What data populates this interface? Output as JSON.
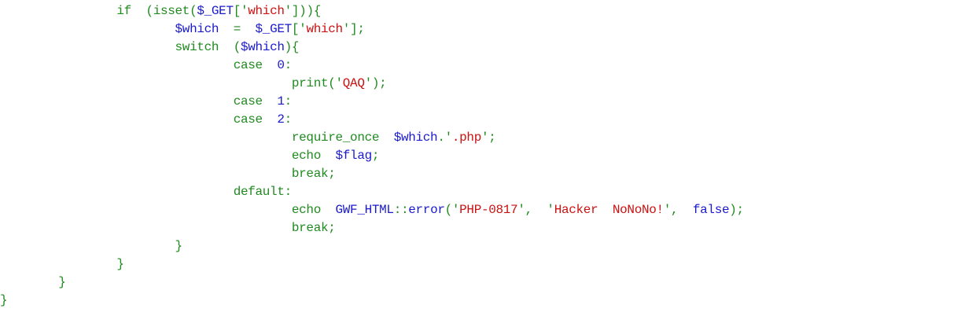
{
  "colors": {
    "keyword": "#1f8a1f",
    "variable": "#1a1acc",
    "string": "#cc1111",
    "punct": "#1f8a1f",
    "plain": "#1f8a1f"
  },
  "code": {
    "lines": [
      [
        {
          "t": "                ",
          "c": "plain"
        },
        {
          "t": "if",
          "c": "keyword"
        },
        {
          "t": "  (isset(",
          "c": "plain"
        },
        {
          "t": "$_GET",
          "c": "variable"
        },
        {
          "t": "['",
          "c": "punct"
        },
        {
          "t": "which",
          "c": "string"
        },
        {
          "t": "'])){",
          "c": "punct"
        }
      ],
      [
        {
          "t": "                        ",
          "c": "plain"
        },
        {
          "t": "$which",
          "c": "variable"
        },
        {
          "t": "  =  ",
          "c": "punct"
        },
        {
          "t": "$_GET",
          "c": "variable"
        },
        {
          "t": "['",
          "c": "punct"
        },
        {
          "t": "which",
          "c": "string"
        },
        {
          "t": "'];",
          "c": "punct"
        }
      ],
      [
        {
          "t": "                        ",
          "c": "plain"
        },
        {
          "t": "switch",
          "c": "keyword"
        },
        {
          "t": "  (",
          "c": "punct"
        },
        {
          "t": "$which",
          "c": "variable"
        },
        {
          "t": "){",
          "c": "punct"
        }
      ],
      [
        {
          "t": "                                ",
          "c": "plain"
        },
        {
          "t": "case",
          "c": "keyword"
        },
        {
          "t": "  ",
          "c": "plain"
        },
        {
          "t": "0",
          "c": "variable"
        },
        {
          "t": ":",
          "c": "punct"
        }
      ],
      [
        {
          "t": "                                        ",
          "c": "plain"
        },
        {
          "t": "print",
          "c": "keyword"
        },
        {
          "t": "('",
          "c": "punct"
        },
        {
          "t": "QAQ",
          "c": "string"
        },
        {
          "t": "');",
          "c": "punct"
        }
      ],
      [
        {
          "t": "                                ",
          "c": "plain"
        },
        {
          "t": "case",
          "c": "keyword"
        },
        {
          "t": "  ",
          "c": "plain"
        },
        {
          "t": "1",
          "c": "variable"
        },
        {
          "t": ":",
          "c": "punct"
        }
      ],
      [
        {
          "t": "                                ",
          "c": "plain"
        },
        {
          "t": "case",
          "c": "keyword"
        },
        {
          "t": "  ",
          "c": "plain"
        },
        {
          "t": "2",
          "c": "variable"
        },
        {
          "t": ":",
          "c": "punct"
        }
      ],
      [
        {
          "t": "                                        ",
          "c": "plain"
        },
        {
          "t": "require_once",
          "c": "keyword"
        },
        {
          "t": "  ",
          "c": "plain"
        },
        {
          "t": "$which",
          "c": "variable"
        },
        {
          "t": ".'",
          "c": "punct"
        },
        {
          "t": ".php",
          "c": "string"
        },
        {
          "t": "';",
          "c": "punct"
        }
      ],
      [
        {
          "t": "                                        ",
          "c": "plain"
        },
        {
          "t": "echo",
          "c": "keyword"
        },
        {
          "t": "  ",
          "c": "plain"
        },
        {
          "t": "$flag",
          "c": "variable"
        },
        {
          "t": ";",
          "c": "punct"
        }
      ],
      [
        {
          "t": "                                        ",
          "c": "plain"
        },
        {
          "t": "break",
          "c": "keyword"
        },
        {
          "t": ";",
          "c": "punct"
        }
      ],
      [
        {
          "t": "                                ",
          "c": "plain"
        },
        {
          "t": "default",
          "c": "keyword"
        },
        {
          "t": ":",
          "c": "punct"
        }
      ],
      [
        {
          "t": "                                        ",
          "c": "plain"
        },
        {
          "t": "echo",
          "c": "keyword"
        },
        {
          "t": "  ",
          "c": "plain"
        },
        {
          "t": "GWF_HTML",
          "c": "variable"
        },
        {
          "t": "::",
          "c": "punct"
        },
        {
          "t": "error",
          "c": "variable"
        },
        {
          "t": "('",
          "c": "punct"
        },
        {
          "t": "PHP-0817",
          "c": "string"
        },
        {
          "t": "',  '",
          "c": "punct"
        },
        {
          "t": "Hacker  NoNoNo!",
          "c": "string"
        },
        {
          "t": "',  ",
          "c": "punct"
        },
        {
          "t": "false",
          "c": "variable"
        },
        {
          "t": ");",
          "c": "punct"
        }
      ],
      [
        {
          "t": "                                        ",
          "c": "plain"
        },
        {
          "t": "break",
          "c": "keyword"
        },
        {
          "t": ";",
          "c": "punct"
        }
      ],
      [
        {
          "t": "                        ",
          "c": "plain"
        },
        {
          "t": "}",
          "c": "punct"
        }
      ],
      [
        {
          "t": "                ",
          "c": "plain"
        },
        {
          "t": "}",
          "c": "punct"
        }
      ],
      [
        {
          "t": "        ",
          "c": "plain"
        },
        {
          "t": "}",
          "c": "punct"
        }
      ],
      [
        {
          "t": "}",
          "c": "punct"
        }
      ]
    ]
  }
}
